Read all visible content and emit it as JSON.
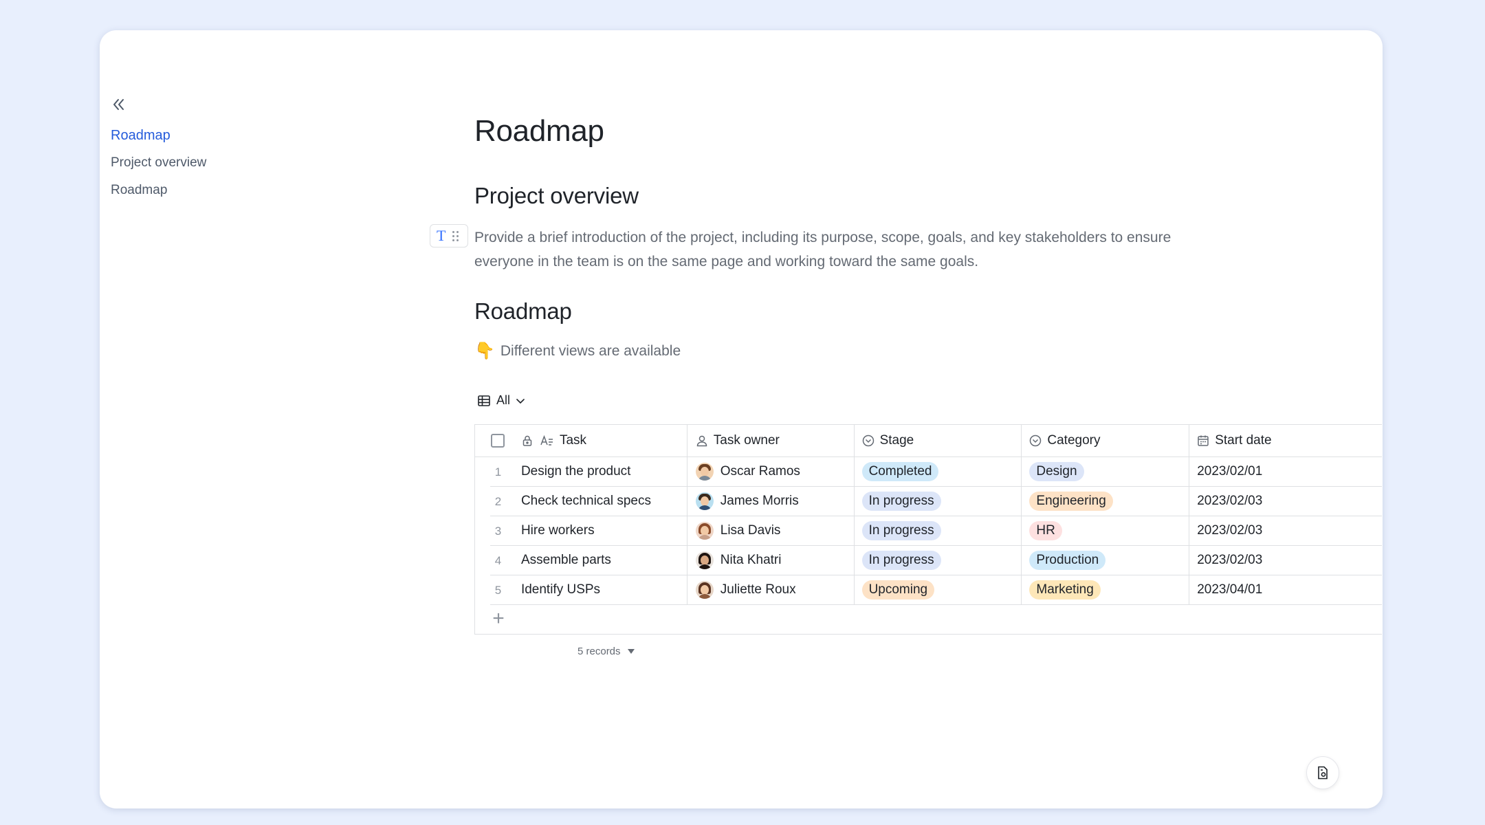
{
  "toc": {
    "items": [
      {
        "label": "Roadmap"
      },
      {
        "label": "Project overview"
      },
      {
        "label": "Roadmap"
      }
    ]
  },
  "doc": {
    "title": "Roadmap",
    "overview_heading": "Project overview",
    "overview_text": "Provide a brief introduction of the project, including its purpose, scope, goals, and key stakeholders to ensure everyone in the team is on the same page and working toward the same goals.",
    "roadmap_heading": "Roadmap",
    "hint_emoji": "👇",
    "hint_text": "Different views are available",
    "block_handle_glyph": "T"
  },
  "view": {
    "label": "All"
  },
  "table": {
    "columns": {
      "task": "Task",
      "owner": "Task owner",
      "stage": "Stage",
      "category": "Category",
      "start_date": "Start date"
    },
    "rows": [
      {
        "index": "1",
        "task": "Design the product",
        "owner": "Oscar Ramos",
        "stage": "Completed",
        "category": "Design",
        "start_date": "2023/02/01"
      },
      {
        "index": "2",
        "task": "Check technical specs",
        "owner": "James Morris",
        "stage": "In progress",
        "category": "Engineering",
        "start_date": "2023/02/03"
      },
      {
        "index": "3",
        "task": "Hire workers",
        "owner": "Lisa Davis",
        "stage": "In progress",
        "category": "HR",
        "start_date": "2023/02/03"
      },
      {
        "index": "4",
        "task": "Assemble parts",
        "owner": "Nita Khatri",
        "stage": "In progress",
        "category": "Production",
        "start_date": "2023/02/03"
      },
      {
        "index": "5",
        "task": "Identify USPs",
        "owner": "Juliette Roux",
        "stage": "Upcoming",
        "category": "Marketing",
        "start_date": "2023/04/01"
      }
    ],
    "records_label": "5 records",
    "add_glyph": "+"
  },
  "colors": {
    "accent": "#245bdb",
    "stage_completed": "#cfe9f9",
    "stage_in_progress": "#dce5f8",
    "stage_upcoming": "#fde2c6",
    "cat_design": "#dce5f8",
    "cat_engineering": "#fde2c6",
    "cat_hr": "#fde0e0",
    "cat_production": "#cfe9f9",
    "cat_marketing": "#fde7b8"
  }
}
